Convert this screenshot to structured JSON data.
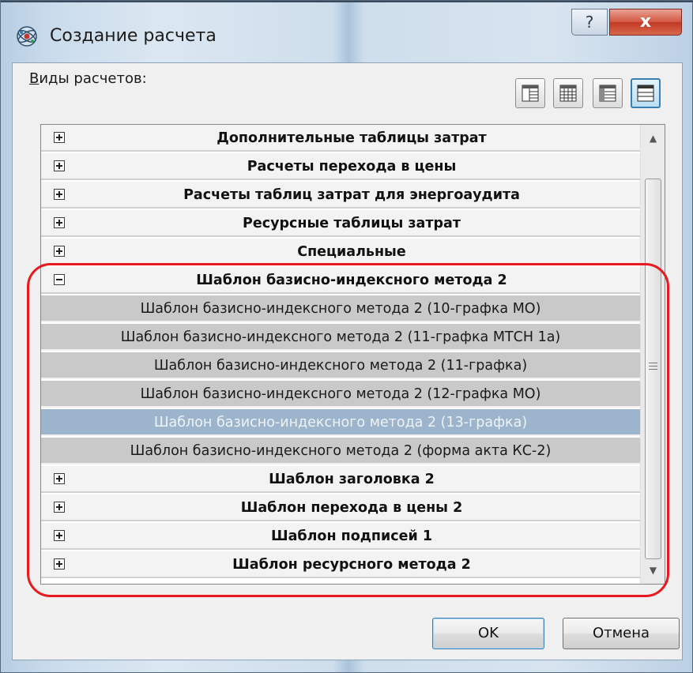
{
  "window": {
    "title": "Создание расчета",
    "help_glyph": "?",
    "close_glyph": "x"
  },
  "calc_types_label_u": "В",
  "calc_types_label_rest": "иды расчетов:",
  "view_buttons": [
    {
      "name": "view-mode-1-icon"
    },
    {
      "name": "view-mode-2-icon"
    },
    {
      "name": "view-mode-3-icon"
    },
    {
      "name": "view-mode-4-icon",
      "active": true
    }
  ],
  "list": {
    "rows": [
      {
        "type": "group",
        "expanded": false,
        "label": "Дополнительные таблицы затрат"
      },
      {
        "type": "group",
        "expanded": false,
        "label": "Расчеты перехода в цены"
      },
      {
        "type": "group",
        "expanded": false,
        "label": "Расчеты таблиц затрат для энергоаудита"
      },
      {
        "type": "group",
        "expanded": false,
        "label": "Ресурсные таблицы затрат"
      },
      {
        "type": "group",
        "expanded": false,
        "label": "Специальные"
      },
      {
        "type": "group",
        "expanded": true,
        "label": "Шаблон базисно-индексного метода 2"
      },
      {
        "type": "child",
        "label": "Шаблон базисно-индексного метода 2 (10-графка МО)"
      },
      {
        "type": "child",
        "label": "Шаблон базисно-индексного метода 2 (11-графка МТСН 1а)"
      },
      {
        "type": "child",
        "label": "Шаблон базисно-индексного метода 2 (11-графка)"
      },
      {
        "type": "child",
        "label": "Шаблон базисно-индексного метода 2 (12-графка МО)"
      },
      {
        "type": "child",
        "selected": true,
        "label": "Шаблон базисно-индексного метода 2 (13-графка)"
      },
      {
        "type": "child",
        "label": "Шаблон базисно-индексного метода 2 (форма акта КС-2)"
      },
      {
        "type": "group",
        "expanded": false,
        "label": "Шаблон заголовка 2"
      },
      {
        "type": "group",
        "expanded": false,
        "label": "Шаблон перехода в цены 2"
      },
      {
        "type": "group",
        "expanded": false,
        "label": "Шаблон подписей 1"
      },
      {
        "type": "group",
        "expanded": false,
        "label": "Шаблон ресурсного метода 2"
      }
    ]
  },
  "buttons": {
    "ok": "OK",
    "cancel": "Отмена"
  },
  "colors": {
    "annotation": "#e8191f",
    "selected_row": "#9cb4cc",
    "child_row": "#c9c9c9"
  }
}
